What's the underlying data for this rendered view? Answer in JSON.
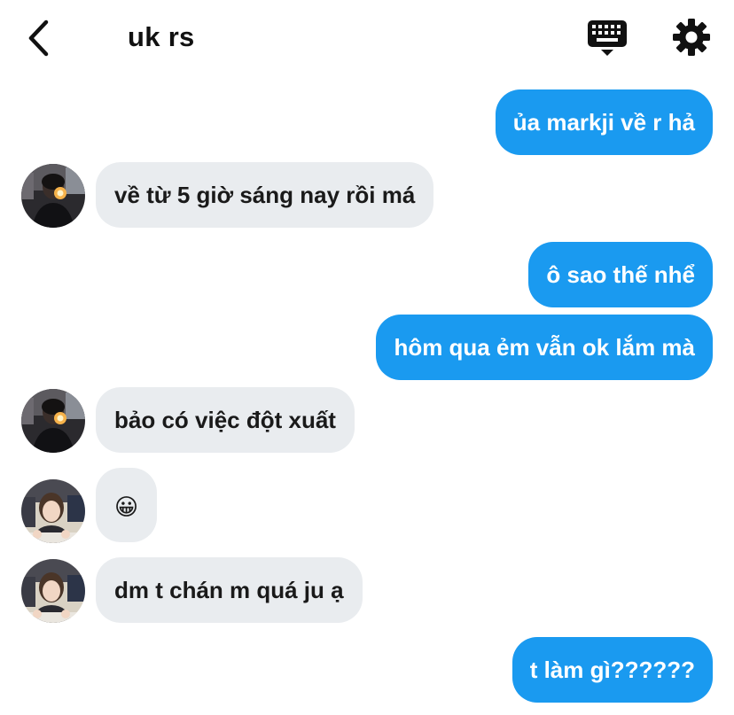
{
  "header": {
    "title": "uk rs",
    "back_icon": "chevron-left-icon",
    "keyboard_icon": "keyboard-icon",
    "settings_icon": "gear-icon"
  },
  "colors": {
    "outgoing_bubble": "#1a9af0",
    "incoming_bubble": "#e9ecef",
    "icon": "#111111"
  },
  "messages": [
    {
      "direction": "out",
      "text": "ủa markji về r hả"
    },
    {
      "direction": "in",
      "sender": "contact-1",
      "text": "về từ 5 giờ sáng nay rồi má"
    },
    {
      "direction": "out",
      "text": "ô sao thế nhể"
    },
    {
      "direction": "out",
      "text": "hôm qua ẻm vẫn ok lắm mà"
    },
    {
      "direction": "in",
      "sender": "contact-1",
      "text": "bảo có việc đột xuất"
    },
    {
      "direction": "in",
      "sender": "contact-2",
      "text": "😀"
    },
    {
      "direction": "in",
      "sender": "contact-2",
      "text": "dm t chán m quá ju ạ"
    },
    {
      "direction": "out",
      "text": "t làm gì??????"
    }
  ]
}
